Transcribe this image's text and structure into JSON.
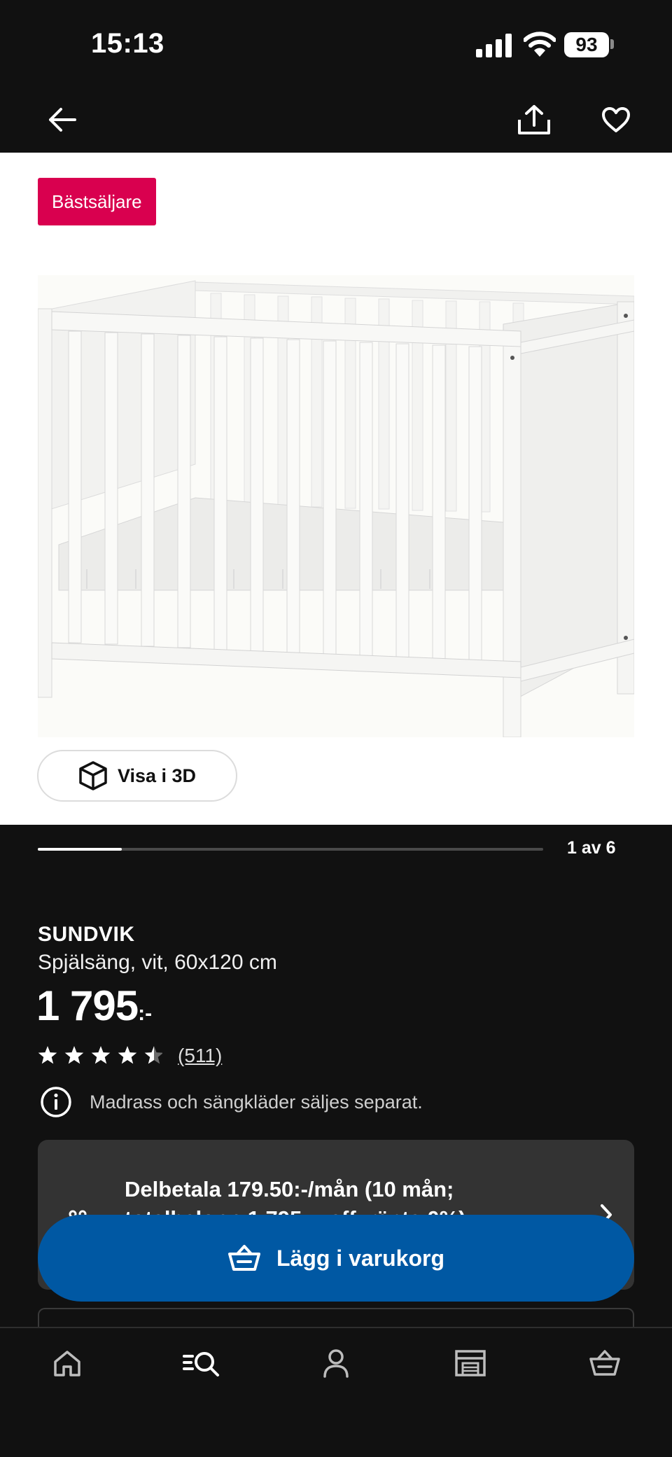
{
  "status_bar": {
    "time": "15:13",
    "battery": "93"
  },
  "nav": {
    "back_icon": "arrow-left-icon",
    "share_icon": "share-icon",
    "favorite_icon": "heart-icon"
  },
  "image_area": {
    "badge": "Bästsäljare",
    "image_alt": "crib-photo",
    "view3d_label": "Visa i 3D"
  },
  "carousel": {
    "label": "1 av 6",
    "current": 1,
    "total": 6
  },
  "product": {
    "name": "SUNDVIK",
    "description": "Spjälsäng, vit, 60x120 cm",
    "price": "1 795",
    "price_suffix": ":-",
    "rating": 4.5,
    "review_count": "(511)",
    "info": "Madrass och sängkläder säljes separat."
  },
  "finance": {
    "line1": "Delbetala 179.50:-/mån (10 mån;",
    "line2": "totalbelopp 1 795:-; eff. ränta 0%)"
  },
  "cta": {
    "label": "Lägg i varukorg"
  },
  "tabs": [
    {
      "name": "home",
      "icon": "home-icon"
    },
    {
      "name": "search",
      "icon": "search-icon"
    },
    {
      "name": "profile",
      "icon": "user-icon"
    },
    {
      "name": "store",
      "icon": "store-icon"
    },
    {
      "name": "cart",
      "icon": "basket-icon"
    }
  ],
  "colors": {
    "accent": "#0058a3",
    "badge": "#d9004f",
    "background": "#111111",
    "card": "#333333"
  }
}
